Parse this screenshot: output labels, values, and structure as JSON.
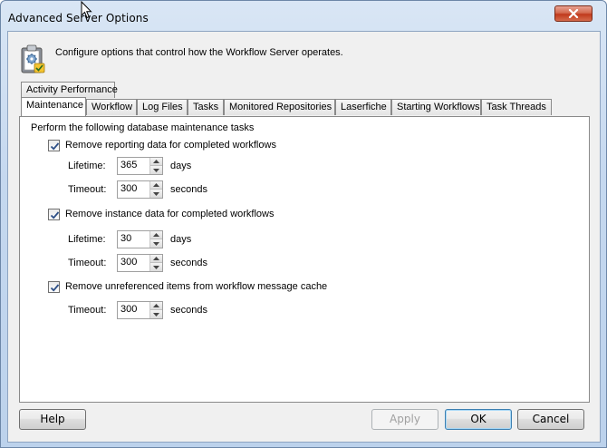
{
  "window": {
    "title": "Advanced Server Options"
  },
  "header": {
    "description": "Configure options that control how the Workflow Server operates.",
    "icon": "clipboard-gear-check-icon"
  },
  "tabs": {
    "row_top": [
      {
        "label": "Activity Performance"
      }
    ],
    "row_bottom": [
      {
        "label": "Maintenance",
        "active": true
      },
      {
        "label": "Workflow"
      },
      {
        "label": "Log Files"
      },
      {
        "label": "Tasks"
      },
      {
        "label": "Monitored Repositories"
      },
      {
        "label": "Laserfiche"
      },
      {
        "label": "Starting Workflows"
      },
      {
        "label": "Task Threads"
      }
    ]
  },
  "maintenance": {
    "intro": "Perform the following database maintenance tasks",
    "reporting": {
      "label": "Remove reporting data for completed workflows",
      "checked": true,
      "lifetime_label": "Lifetime:",
      "lifetime_value": "365",
      "lifetime_unit": "days",
      "timeout_label": "Timeout:",
      "timeout_value": "300",
      "timeout_unit": "seconds"
    },
    "instance": {
      "label": "Remove instance data for completed workflows",
      "checked": true,
      "lifetime_label": "Lifetime:",
      "lifetime_value": "30",
      "lifetime_unit": "days",
      "timeout_label": "Timeout:",
      "timeout_value": "300",
      "timeout_unit": "seconds"
    },
    "cache": {
      "label": "Remove unreferenced items from workflow message cache",
      "checked": true,
      "timeout_label": "Timeout:",
      "timeout_value": "300",
      "timeout_unit": "seconds"
    }
  },
  "buttons": {
    "help": "Help",
    "apply": "Apply",
    "ok": "OK",
    "cancel": "Cancel"
  },
  "colors": {
    "title_bar": "#c5d8ef",
    "close_button": "#c0391c",
    "dialog_background": "#f0f0f0",
    "default_button_border": "#3c7fb1"
  }
}
